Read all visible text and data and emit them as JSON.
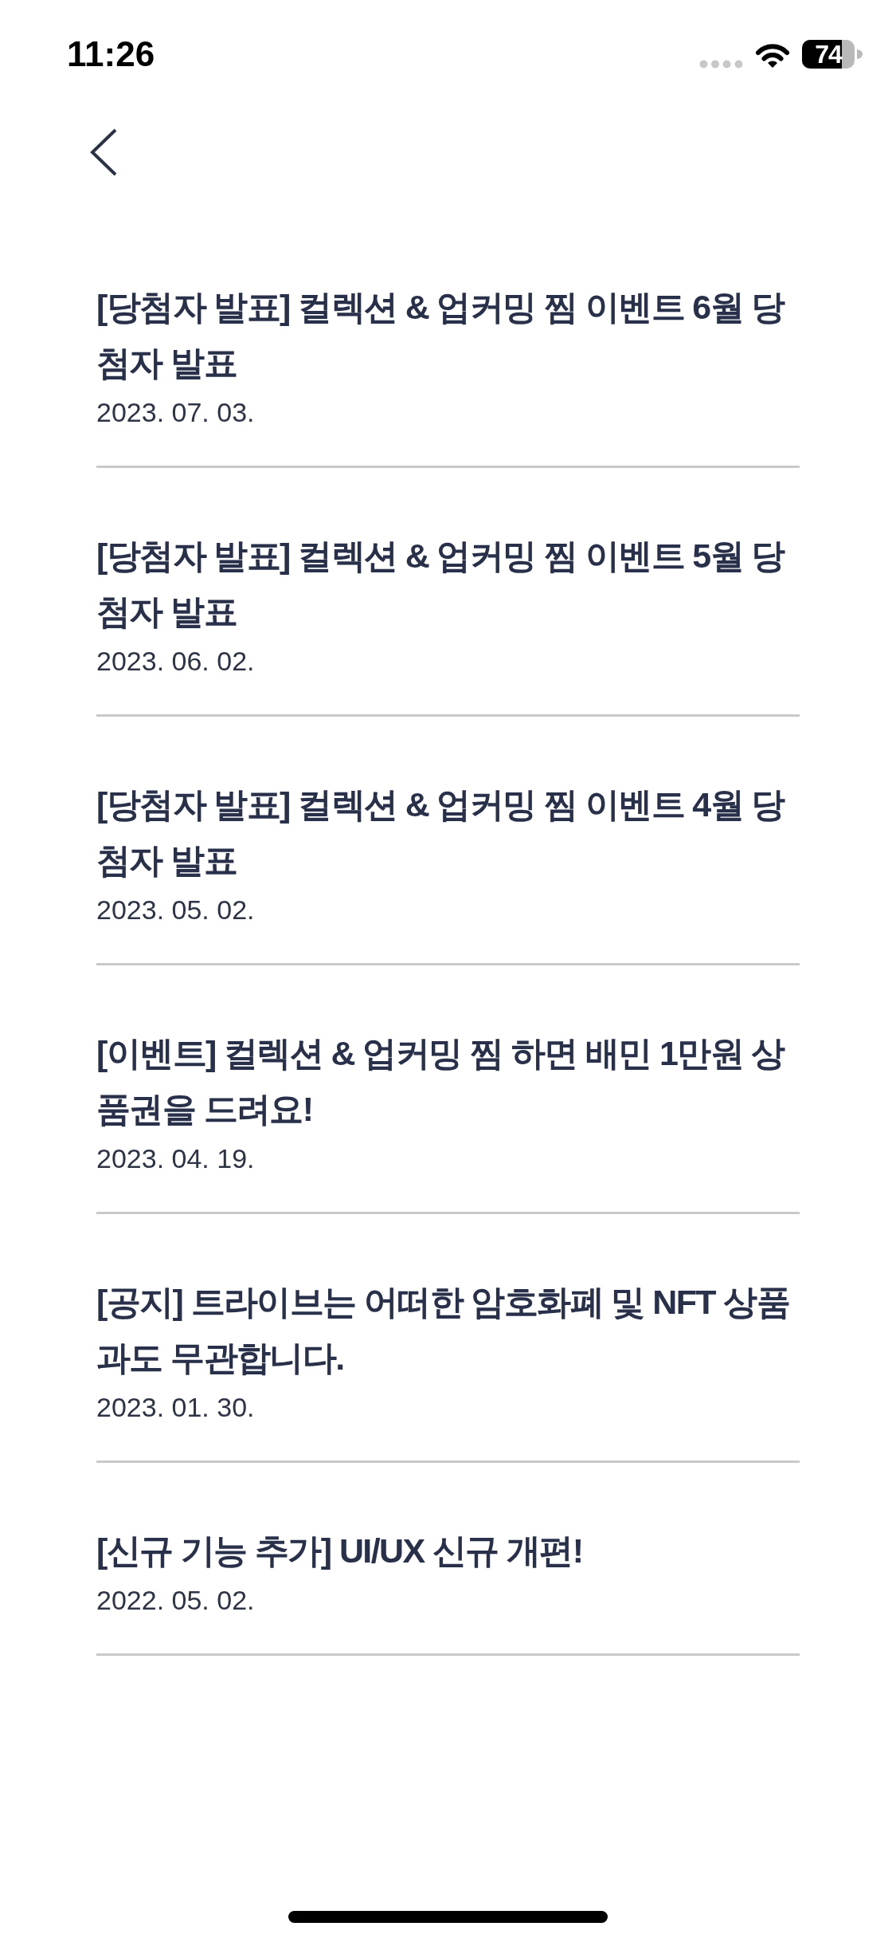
{
  "status_bar": {
    "time": "11:26",
    "battery": "74"
  },
  "notices": [
    {
      "title": "[당첨자 발표] 컬렉션 & 업커밍 찜 이벤트 6월 당첨자 발표",
      "date": "2023. 07. 03."
    },
    {
      "title": "[당첨자 발표] 컬렉션 & 업커밍 찜 이벤트 5월 당첨자 발표",
      "date": "2023. 06. 02."
    },
    {
      "title": "[당첨자 발표] 컬렉션 & 업커밍 찜 이벤트 4월 당첨자 발표",
      "date": "2023. 05. 02."
    },
    {
      "title": "[이벤트] 컬렉션 & 업커밍 찜 하면 배민 1만원 상품권을 드려요!",
      "date": "2023. 04. 19."
    },
    {
      "title": "[공지] 트라이브는 어떠한 암호화폐 및 NFT 상품과도 무관합니다.",
      "date": "2023. 01. 30."
    },
    {
      "title": "[신규 기능 추가] UI/UX 신규 개편!",
      "date": "2022. 05. 02."
    }
  ]
}
